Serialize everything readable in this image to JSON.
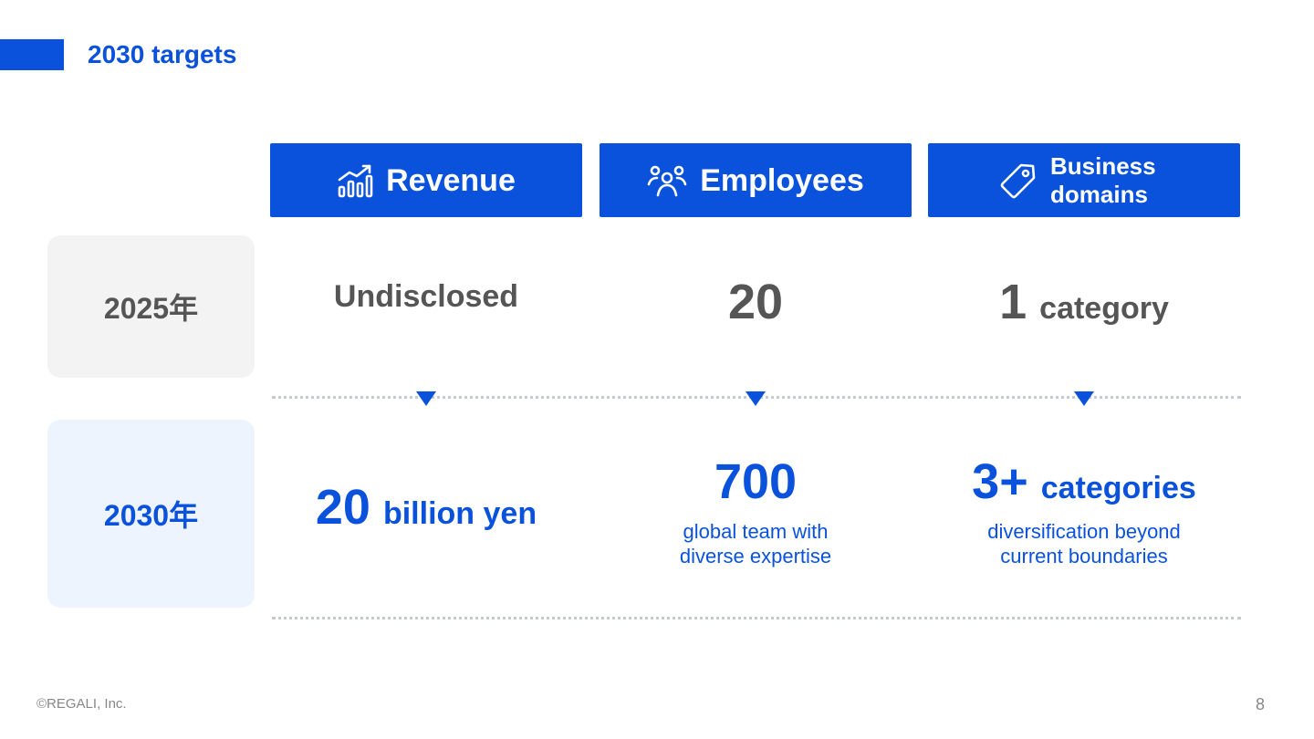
{
  "slide": {
    "title": "2030 targets",
    "footer": "©REGALI, Inc.",
    "page_number": "8"
  },
  "columns": [
    {
      "label": "Revenue",
      "icon": "bar-chart-growth-icon"
    },
    {
      "label": "Employees",
      "icon": "people-group-icon"
    },
    {
      "label_line1": "Business",
      "label_line2": "domains",
      "icon": "tag-icon"
    }
  ],
  "rows": {
    "y2025": {
      "label": "2025年",
      "revenue": "Undisclosed",
      "employees": "20",
      "domains_num": "1",
      "domains_unit": "category"
    },
    "y2030": {
      "label": "2030年",
      "revenue_num": "20",
      "revenue_unit": "billion yen",
      "employees_num": "700",
      "employees_desc_line1": "global team with",
      "employees_desc_line2": "diverse expertise",
      "domains_num": "3+",
      "domains_unit": "categories",
      "domains_desc_line1": "diversification beyond",
      "domains_desc_line2": "current boundaries"
    }
  },
  "colors": {
    "accent": "#0a52db",
    "text_grey": "#555555",
    "box_grey": "#f3f3f3",
    "box_blue": "#eef4fe"
  }
}
